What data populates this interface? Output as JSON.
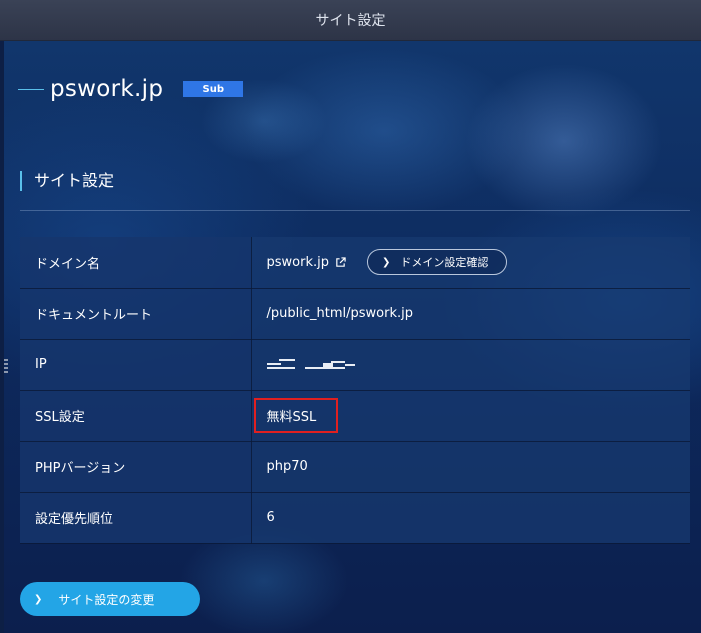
{
  "window": {
    "title": "サイト設定"
  },
  "site": {
    "domain": "pswork.jp",
    "badge": "Sub"
  },
  "section": {
    "title": "サイト設定"
  },
  "rows": [
    {
      "label": "ドメイン名",
      "value": "pswork.jp",
      "button": "ドメイン設定確認"
    },
    {
      "label": "ドキュメントルート",
      "value": "/public_html/pswork.jp"
    },
    {
      "label": "IP",
      "value": ""
    },
    {
      "label": "SSL設定",
      "value": "無料SSL"
    },
    {
      "label": "PHPバージョン",
      "value": "php70"
    },
    {
      "label": "設定優先順位",
      "value": "6"
    }
  ],
  "actions": {
    "change_label": "サイト設定の変更"
  },
  "icons": {
    "external_link": "external-link-icon",
    "chevron": "chevron-right-icon"
  },
  "colors": {
    "accent": "#23a5e6",
    "badge": "#2f76e6",
    "highlight": "#e02020"
  }
}
